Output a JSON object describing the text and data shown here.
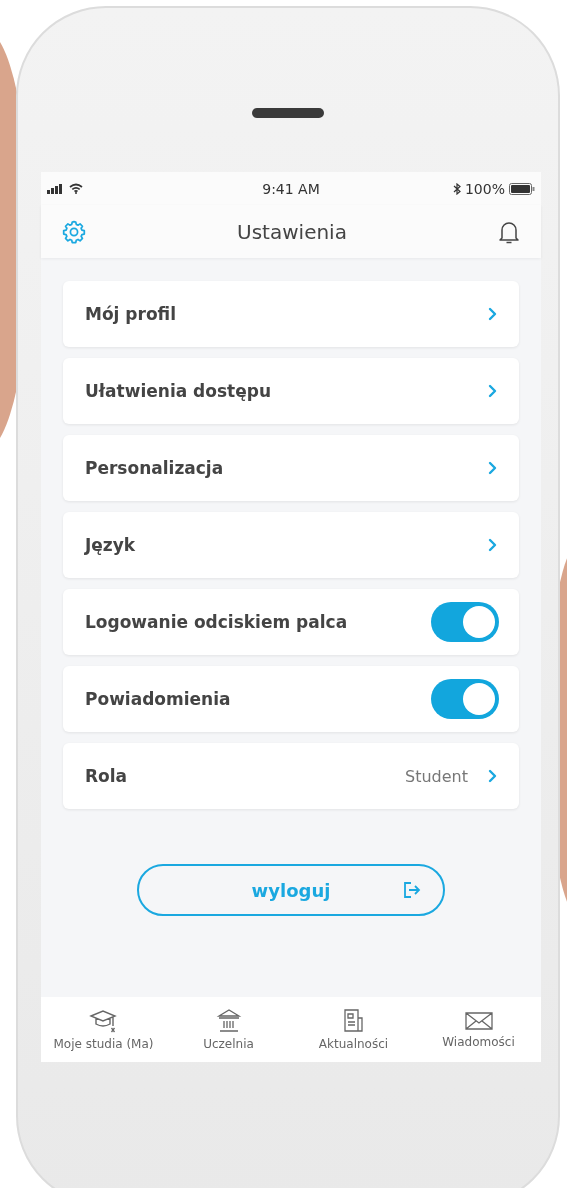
{
  "status_bar": {
    "time": "9:41 AM",
    "battery": "100%"
  },
  "header": {
    "title": "Ustawienia"
  },
  "settings": [
    {
      "kind": "link",
      "label": "Mój profil"
    },
    {
      "kind": "link",
      "label": "Ułatwienia dostępu"
    },
    {
      "kind": "link",
      "label": "Personalizacja"
    },
    {
      "kind": "link",
      "label": "Język"
    },
    {
      "kind": "toggle",
      "label": "Logowanie odciskiem palca",
      "on": true
    },
    {
      "kind": "toggle",
      "label": "Powiadomienia",
      "on": true
    },
    {
      "kind": "value",
      "label": "Rola",
      "value": "Student"
    }
  ],
  "logout_button": {
    "label": "wyloguj"
  },
  "tab_bar": [
    {
      "kind": "studies",
      "label": "Moje studia (Ma)"
    },
    {
      "kind": "university",
      "label": "Uczelnia"
    },
    {
      "kind": "news",
      "label": "Aktualności"
    },
    {
      "kind": "messages",
      "label": "Wiadomości"
    }
  ]
}
